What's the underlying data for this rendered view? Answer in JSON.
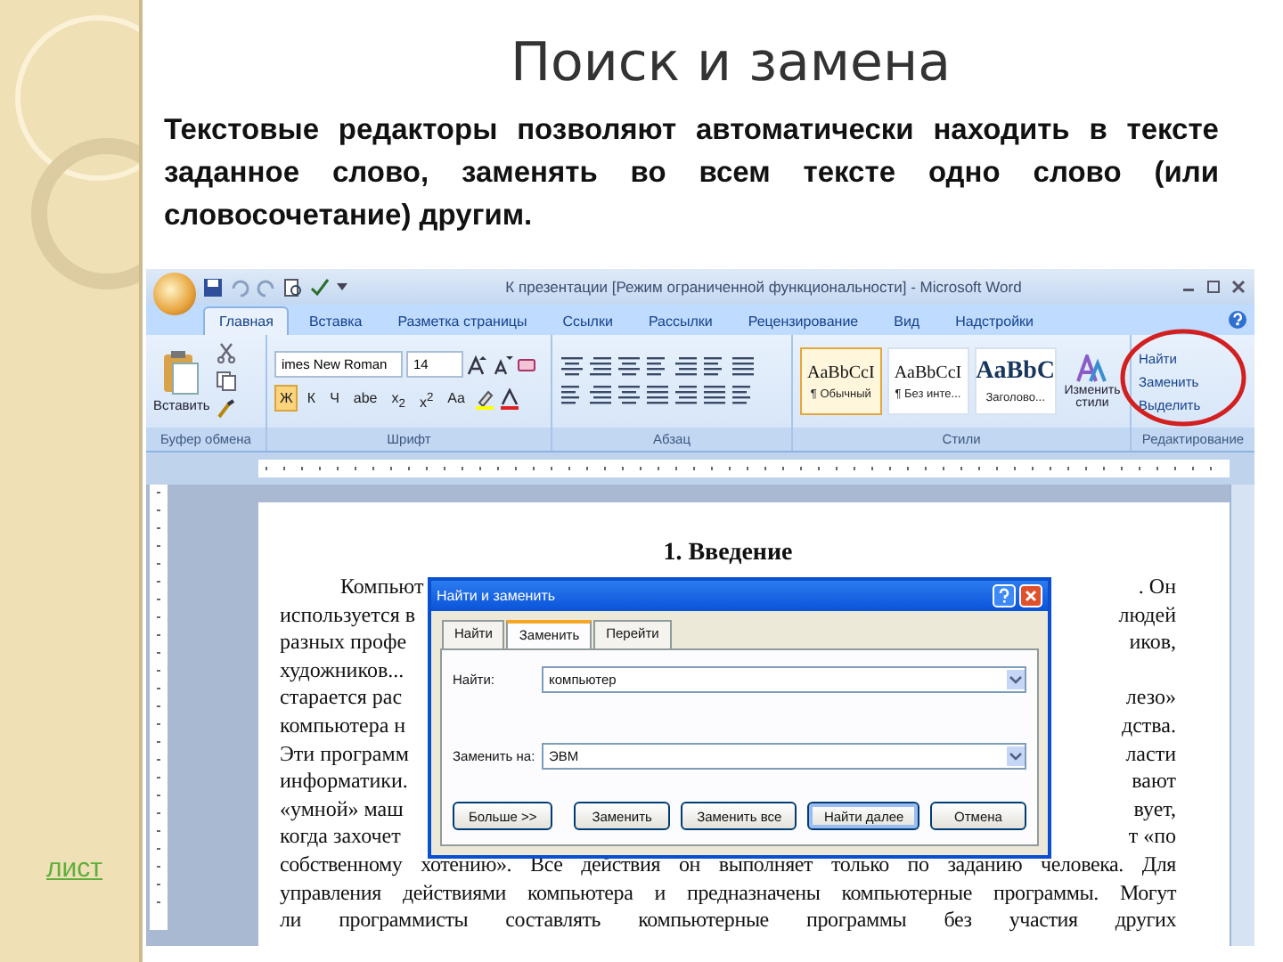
{
  "slide": {
    "title": "Поиск и замена",
    "text": "Текстовые редакторы позволяют автоматически находить в тексте заданное слово, заменять во всем тексте одно слово (или словосочетание) другим.",
    "link": "лист"
  },
  "word": {
    "title": "К презентации [Режим ограниченной функциональности] - Microsoft Word",
    "tabs": [
      {
        "label": "Главная",
        "selected": true
      },
      {
        "label": "Вставка",
        "selected": false
      },
      {
        "label": "Разметка страницы",
        "selected": false
      },
      {
        "label": "Ссылки",
        "selected": false
      },
      {
        "label": "Рассылки",
        "selected": false
      },
      {
        "label": "Рецензирование",
        "selected": false
      },
      {
        "label": "Вид",
        "selected": false
      },
      {
        "label": "Надстройки",
        "selected": false
      }
    ],
    "ribbon": {
      "clipboard": {
        "label": "Буфер обмена",
        "paste": "Вставить"
      },
      "font": {
        "label": "Шрифт",
        "face": "imes New Roman",
        "size": "14",
        "format": [
          {
            "label": "Ж",
            "active": true
          },
          {
            "label": "К",
            "active": false
          },
          {
            "label": "Ч",
            "active": false
          },
          {
            "label": "abe",
            "active": false
          },
          {
            "label": "x$_{2}$",
            "active": false
          },
          {
            "label": "x$^{2}$",
            "active": false
          },
          {
            "label": "Aa",
            "active": false
          }
        ]
      },
      "paragraph": {
        "label": "Абзац"
      },
      "styles": {
        "label": "Стили",
        "change": "Изменить стили",
        "items": [
          {
            "preview": "AaBbCcI",
            "name": "¶ Обычный",
            "selected": true
          },
          {
            "preview": "AaBbCcI",
            "name": "¶ Без инте...",
            "selected": false
          },
          {
            "preview": "AaBbC",
            "name": "Заголово...",
            "selected": false
          }
        ]
      },
      "editing": {
        "label": "Редактирование",
        "items": [
          "Найти",
          "Заменить",
          "Выделить"
        ]
      }
    },
    "document": {
      "heading": "1. Введение",
      "lines": [
        {
          "left": "Компьют",
          "right": ". Он",
          "indent": true
        },
        {
          "left": "используется в",
          "right": "людей",
          "indent": false
        },
        {
          "left": "разных профе",
          "right": "иков,",
          "indent": false
        },
        {
          "left": "художников...",
          "indent": false,
          "kind": "split"
        },
        {
          "left": "старается рас",
          "right": "лезо»",
          "indent": false
        },
        {
          "left": "компьютера н",
          "right": "дства.",
          "indent": false
        },
        {
          "left": "Эти программ",
          "right": "ласти",
          "indent": false
        },
        {
          "left": "информатики.",
          "right": "вают",
          "indent": false
        },
        {
          "left": "«умной» маш",
          "right": "вует,",
          "indent": false
        },
        {
          "left": "когда захочет",
          "right": "т «по",
          "indent": false
        },
        {
          "left": "собственному хотению». Все действия он выполняет только по заданию человека. Для",
          "indent": false,
          "kind": "full"
        },
        {
          "left": "управления действиями компьютера и предназначены компьютерные программы. Могут",
          "indent": false,
          "kind": "full"
        },
        {
          "left": "ли программисты составлять компьютерные программы без участия других",
          "indent": false,
          "kind": "full"
        }
      ]
    },
    "dialog": {
      "title": "Найти и заменить",
      "tabs": [
        {
          "label": "Найти",
          "selected": false
        },
        {
          "label": "Заменить",
          "selected": true
        },
        {
          "label": "Перейти",
          "selected": false
        }
      ],
      "find_label": "Найти:",
      "find_value": "компьютер",
      "replace_label": "Заменить на:",
      "replace_value": "ЭВМ",
      "more_button": "Больше >>",
      "buttons": [
        {
          "label": "Заменить",
          "default": false
        },
        {
          "label": "Заменить все",
          "default": false
        },
        {
          "label": "Найти далее",
          "default": true
        },
        {
          "label": "Отмена",
          "default": false
        }
      ]
    }
  }
}
